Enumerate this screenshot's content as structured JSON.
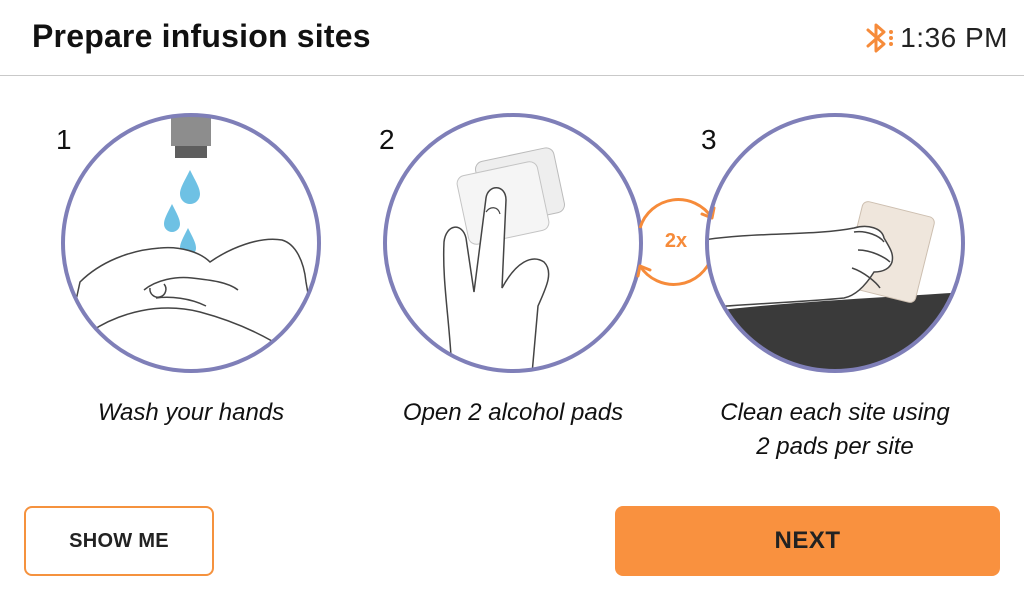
{
  "header": {
    "title": "Prepare infusion sites",
    "time": "1:36 PM",
    "bluetooth_icon": "bluetooth-icon"
  },
  "steps": [
    {
      "number": "1",
      "caption": "Wash your hands",
      "illustration": "washing-hands-icon"
    },
    {
      "number": "2",
      "caption": "Open 2 alcohol pads",
      "illustration": "alcohol-pads-icon"
    },
    {
      "number": "3",
      "caption_line1": "Clean each site using",
      "caption_line2": "2 pads per site",
      "illustration": "cleaning-site-icon"
    }
  ],
  "repeat_badge": {
    "label": "2x",
    "icon": "repeat-arrows-icon"
  },
  "buttons": {
    "show_me": "SHOW ME",
    "next": "NEXT"
  },
  "colors": {
    "accent_orange": "#f9913f",
    "circle_purple": "#7f7fb8",
    "water_blue": "#6ec1e4",
    "bluetooth_orange": "#f68b3a"
  }
}
